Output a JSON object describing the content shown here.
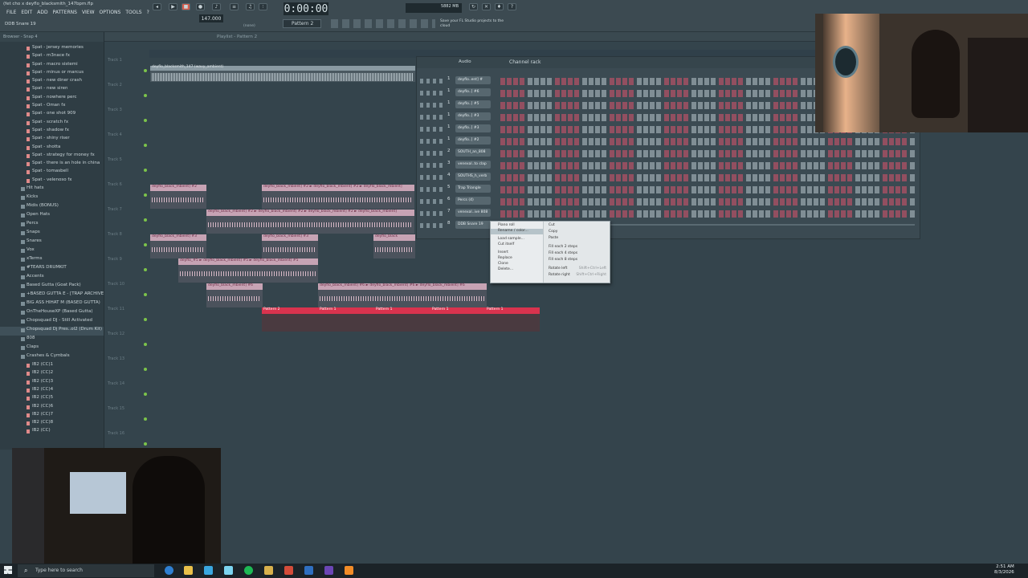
{
  "window": {
    "title": "(fet cho x deyflo_blacksmith_147bpm.flp"
  },
  "menu": [
    "FILE",
    "EDIT",
    "ADD",
    "PATTERNS",
    "VIEW",
    "OPTIONS",
    "TOOLS",
    "?"
  ],
  "hint": "DDB Snare 19",
  "transport": {
    "time": "0:00:00",
    "tempo": "147.000",
    "pattern": "Pattern 2",
    "cpu": "5882 MB",
    "cloud_tip": "Save your FL Studio projects to the cloud",
    "snap": "(none)"
  },
  "browser": {
    "header": "Browser - Snap 4",
    "items": [
      "Spat - jersey memories",
      "Spat - m3nace fx",
      "Spat - macro sistemi",
      "Spat - minus or marcus",
      "Spat - new diner crash",
      "Spat - new siren",
      "Spat - nowhere perc",
      "Spat - Oman fx",
      "Spat - one shot 909",
      "Spat - scratch fx",
      "Spat - shadow fx",
      "Spat - shiny riser",
      "Spat - shotta",
      "Spat - strategy for money fx",
      "Spat - there is an hole in china",
      "Spat - tomasbell",
      "Spat - velenoso fx"
    ],
    "folders_top": [
      "Hit hats",
      "Kicks",
      "Midis (BONUS)",
      "Open Hats",
      "Percs",
      "Snaps",
      "Snares",
      "Vox",
      "xTerms"
    ],
    "folders_bottom": [
      "#TEARS DRUMKIT",
      "Accents",
      "Based Gutta (Goat Pack)",
      "+BASED GUTTA E - [TRAP ARCHIVE]",
      "BIG ASS HIHAT M (BASED GUTTA)",
      "OnTheHouseXP (Based Gutta)",
      "Chopsquad DJ - Still Activated",
      "Chopsquad Dj Pres..ol2 (Drum Kit)",
      "808",
      "Claps",
      "Crashes & Cymbals"
    ],
    "cymbals": [
      "IB2 (CC)1",
      "IB2 (CC)2",
      "IB2 (CC)3",
      "IB2 (CC)4",
      "IB2 (CC)5",
      "IB2 (CC)6",
      "IB2 (CC)7",
      "IB2 (CC)8",
      "IB2 (CC)"
    ]
  },
  "playlist": {
    "title": "Playlist - Pattern 2",
    "tracks": [
      "Track 1",
      "Track 2",
      "Track 3",
      "Track 4",
      "Track 5",
      "Track 6",
      "Track 7",
      "Track 8",
      "Track 9",
      "Track 10",
      "Track 11",
      "Track 12",
      "Track 13",
      "Track 14",
      "Track 15",
      "Track 16"
    ],
    "top_clip": "deyflo_blacksmith_147 (wavy_ambient)",
    "clips": [
      "deyflo_black_mbient] #2",
      "deyflo_black_mbient] #2 ► deyflo_black_mbient] #2 ► deyflo_black_mbient]",
      "deyflo_black_mbient] #2 ► deyflo_black_mbient] #2 ► deyflo_black_mbient] #2 ► deyflo_black_mbient]",
      "deyflo_black_mbient] #3",
      "deyflo_black_mbient] #3",
      "deyflo_black",
      "deyflo_#5 ► deyflo_black_mbient] #5 ► deyflo_black_mbient] #5",
      "deyflo_black_mbient] #6",
      "deyflo_black_mbient] #6 ► deyflo_black_mbient] #6 ► deyflo_black_mbient] #6"
    ],
    "patterns": [
      "Pattern 2",
      "Pattern 1",
      "Pattern 1",
      "Pattern 1",
      "Pattern 1"
    ]
  },
  "rack": {
    "title": "Channel rack",
    "filter": "Audio",
    "channels": [
      {
        "num": "1",
        "name": "deyflo..ent] #"
      },
      {
        "num": "1",
        "name": "deyflo..] #6"
      },
      {
        "num": "1",
        "name": "deyflo..] #5"
      },
      {
        "num": "1",
        "name": "deyflo..] #3"
      },
      {
        "num": "1",
        "name": "deyflo..] #3"
      },
      {
        "num": "1",
        "name": "deyflo..] #2"
      },
      {
        "num": "2",
        "name": "SOUTH_an_808"
      },
      {
        "num": "3",
        "name": "venexal..to clap"
      },
      {
        "num": "4",
        "name": "SOUTHS_h_verb"
      },
      {
        "num": "5",
        "name": "Trap Triangle"
      },
      {
        "num": "6",
        "name": "Percs (4)"
      },
      {
        "num": "7",
        "name": "venexal..ive 808"
      },
      {
        "num": "8",
        "name": "DDB Snare 19"
      }
    ]
  },
  "context_menu": {
    "left": [
      "Piano roll",
      "Rename / color...",
      "Load sample...",
      "Cut itself",
      "Insert",
      "Replace",
      "Clone",
      "Delete..."
    ],
    "right": [
      {
        "label": "Cut",
        "shortcut": ""
      },
      {
        "label": "Copy",
        "shortcut": ""
      },
      {
        "label": "Paste",
        "shortcut": ""
      },
      {
        "label": "Fill each 2 steps",
        "shortcut": ""
      },
      {
        "label": "Fill each 4 steps",
        "shortcut": ""
      },
      {
        "label": "Fill each 8 steps",
        "shortcut": ""
      },
      {
        "label": "Rotate left",
        "shortcut": "Shift+Ctrl+Left"
      },
      {
        "label": "Rotate right",
        "shortcut": "Shift+Ctrl+Right"
      }
    ]
  },
  "taskbar": {
    "search": "Type here to search",
    "time": "2:51 AM",
    "date": "8/3/2026"
  }
}
